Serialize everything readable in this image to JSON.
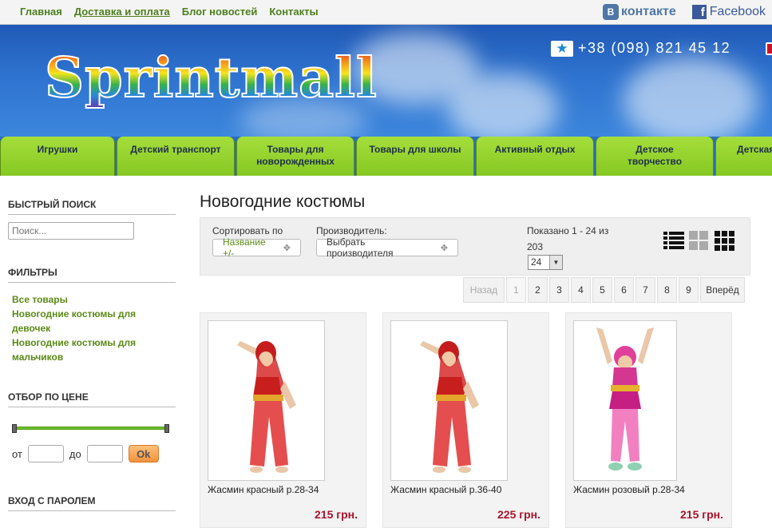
{
  "topnav": [
    "Главная",
    "Доставка и оплата",
    "Блог новостей",
    "Контакты"
  ],
  "social": {
    "vk": "контакте",
    "vk_icon": "В",
    "facebook": "Facebook",
    "facebook_icon": "f"
  },
  "header": {
    "logo": "Sprintmall",
    "phone": "+38 (098) 821 45 12"
  },
  "categories": [
    "Игрушки",
    "Детский транспорт",
    "Товары для новорожденных",
    "Товары для школы",
    "Активный отдых",
    "Детское творчество",
    "Детская"
  ],
  "sidebar": {
    "search_title": "БЫСТРЫЙ ПОИСК",
    "search_placeholder": "Поиск...",
    "filters_title": "ФИЛЬТРЫ",
    "filters": [
      "Все товары",
      "Новогодние костюмы для девочек",
      "Новогодние костюмы для мальчиков"
    ],
    "price_title": "ОТБОР ПО ЦЕНЕ",
    "from": "от",
    "to": "до",
    "ok": "Ok",
    "login_title": "ВХОД С ПАРОЛЕМ"
  },
  "main": {
    "title": "Новогодние костюмы",
    "sort_label": "Сортировать по",
    "sort_value": "Название +/-",
    "maker_label": "Производитель:",
    "maker_value": "Выбрать производителя",
    "shown": "Показано 1 - 24 из",
    "total": "203",
    "per_page": "24"
  },
  "pager": {
    "prev": "Назад",
    "pages": [
      "1",
      "2",
      "3",
      "4",
      "5",
      "6",
      "7",
      "8",
      "9"
    ],
    "current": "1",
    "next": "Вперёд"
  },
  "products": [
    {
      "name": "Жасмин красный р.28-34",
      "price": "215 грн.",
      "color": "red"
    },
    {
      "name": "Жасмин красный р.36-40",
      "price": "225 грн.",
      "color": "red"
    },
    {
      "name": "Жасмин розовый р.28-34",
      "price": "215 грн.",
      "color": "pink"
    }
  ]
}
